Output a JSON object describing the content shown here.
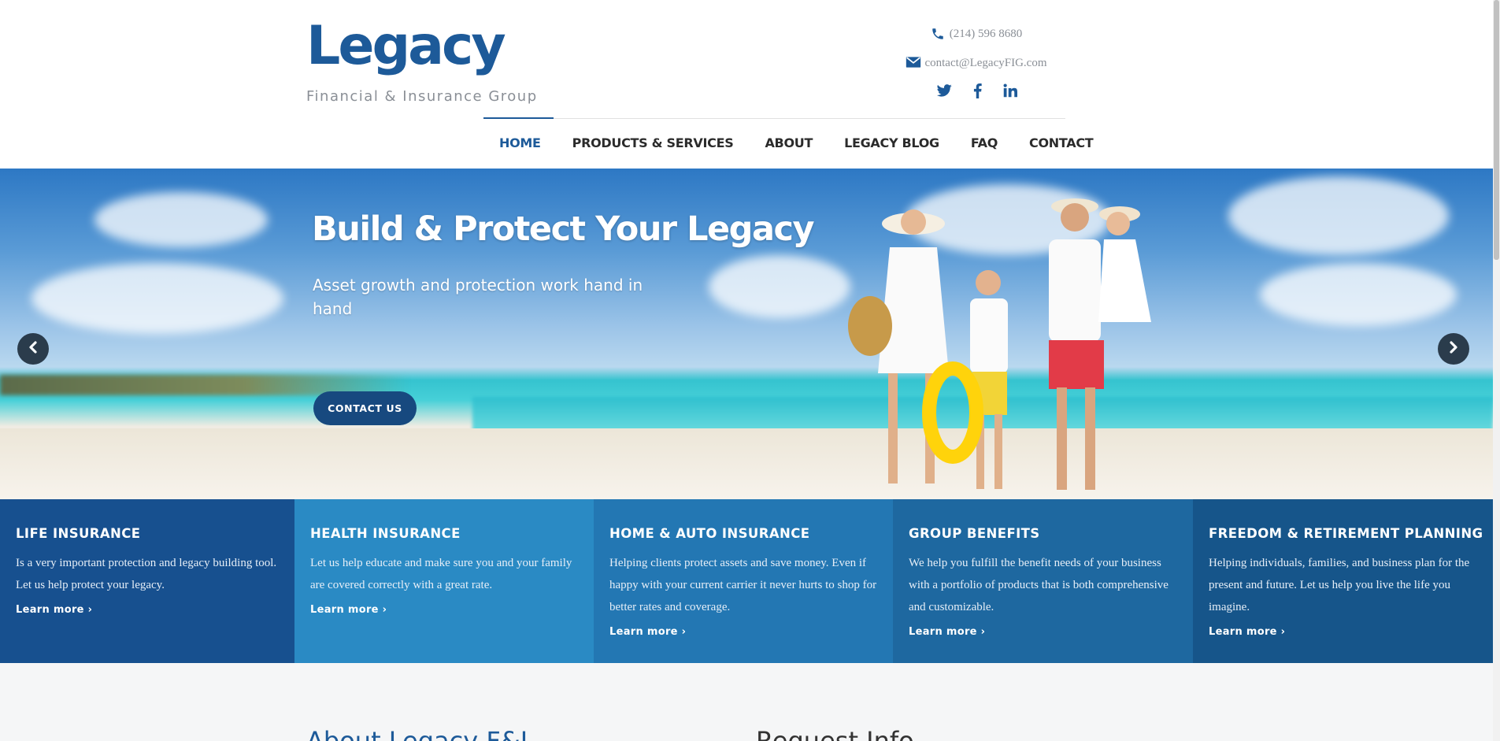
{
  "brand": {
    "name": "Legacy",
    "tagline": "Financial & Insurance Group"
  },
  "contact": {
    "phone": "(214) 596 8680",
    "email": "contact@LegacyFIG.com"
  },
  "social": [
    "twitter-icon",
    "facebook-icon",
    "linkedin-icon"
  ],
  "nav": {
    "items": [
      "HOME",
      "PRODUCTS & SERVICES",
      "ABOUT",
      "LEGACY BLOG",
      "FAQ",
      "CONTACT"
    ],
    "active": "HOME"
  },
  "hero": {
    "title": "Build & Protect Your Legacy",
    "subtitle": "Asset growth and protection work hand in hand",
    "cta": "CONTACT US"
  },
  "services": [
    {
      "title": "LIFE INSURANCE",
      "text": "Is a very important protection and legacy building tool. Let us help protect your legacy.",
      "link": "Learn more",
      "color": "#17508f"
    },
    {
      "title": "HEALTH INSURANCE",
      "text": "Let us help educate and make sure you and your family are covered correctly with a great rate.",
      "link": "Learn more",
      "color": "#2a8ac4"
    },
    {
      "title": "HOME & AUTO INSURANCE",
      "text": "Helping clients protect assets and save money. Even if happy with your current carrier it never hurts to shop for better rates and coverage.",
      "link": "Learn more",
      "color": "#2377b3"
    },
    {
      "title": "GROUP BENEFITS",
      "text": "We help you fulfill the benefit needs of your business with a portfolio of products that is both comprehensive and customizable.",
      "link": "Learn more",
      "color": "#1e68a0"
    },
    {
      "title": "FREEDOM & RETIREMENT PLANNING",
      "text": "Helping individuals, families, and business plan for the present and future. Let us help you live the life you imagine.",
      "link": "Learn more",
      "color": "#16558a"
    }
  ],
  "sections": {
    "about_title": "About Legacy F&I",
    "request_title": "Request Info"
  },
  "colors": {
    "brand_blue": "#1d5a99",
    "cta_blue": "#17497f",
    "muted_gray": "#8a8f96"
  }
}
